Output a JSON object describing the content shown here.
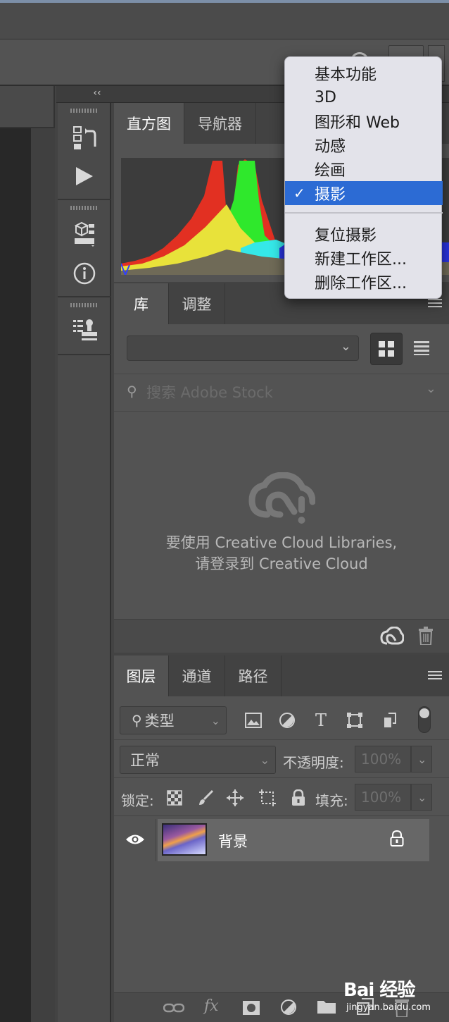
{
  "collapse_label": "‹‹",
  "histogram_panel": {
    "tabs": [
      {
        "label": "直方图",
        "active": true
      },
      {
        "label": "导航器",
        "active": false
      }
    ]
  },
  "workspace_menu": {
    "items": [
      {
        "label": "基本功能",
        "selected": false
      },
      {
        "label": "3D",
        "selected": false
      },
      {
        "label": "图形和 Web",
        "selected": false
      },
      {
        "label": "动感",
        "selected": false
      },
      {
        "label": "绘画",
        "selected": false
      },
      {
        "label": "摄影",
        "selected": true
      }
    ],
    "actions": [
      {
        "label": "复位摄影"
      },
      {
        "label": "新建工作区..."
      },
      {
        "label": "删除工作区..."
      }
    ],
    "check_mark": "✓",
    "selected_color": "#2c6bd4"
  },
  "libraries_panel": {
    "tabs": [
      {
        "label": "库",
        "active": true
      },
      {
        "label": "调整",
        "active": false
      }
    ],
    "select_value": "",
    "search_placeholder": "搜索 Adobe Stock",
    "message_line1": "要使用 Creative Cloud Libraries,",
    "message_line2": "请登录到 Creative Cloud"
  },
  "layers_panel": {
    "tabs": [
      {
        "label": "图层",
        "active": true
      },
      {
        "label": "通道",
        "active": false
      },
      {
        "label": "路径",
        "active": false
      }
    ],
    "filter_type": "类型",
    "blend_mode": "正常",
    "opacity_label": "不透明度:",
    "opacity_value": "100%",
    "lock_label": "锁定:",
    "fill_label": "填充:",
    "fill_value": "100%",
    "layers": [
      {
        "name": "背景",
        "visible": true,
        "locked": true
      }
    ],
    "footer_icons": [
      "link-icon",
      "fx-icon",
      "mask-icon",
      "adjustment-icon",
      "folder-icon",
      "new-layer-icon",
      "trash-icon"
    ],
    "fx_label": "fx"
  },
  "watermark": {
    "text": "Bai 经验",
    "url": "jingyan.baidu.com"
  }
}
